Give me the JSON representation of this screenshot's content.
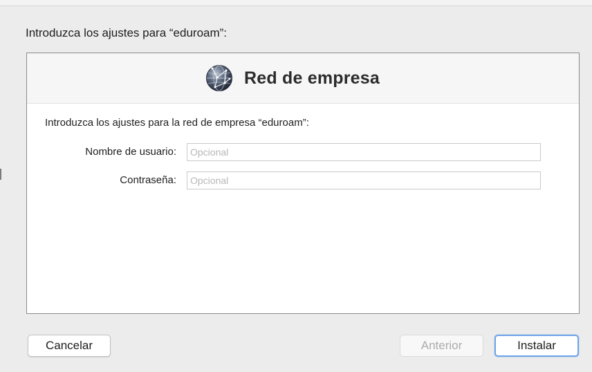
{
  "dialog": {
    "prompt": "Introduzca los ajustes para “eduroam”:"
  },
  "panel": {
    "icon": "network-globe-icon",
    "title": "Red de empresa",
    "instructions": "Introduzca los ajustes para la red de empresa “eduroam”:",
    "fields": {
      "username": {
        "label": "Nombre de usuario:",
        "value": "",
        "placeholder": "Opcional"
      },
      "password": {
        "label": "Contraseña:",
        "value": "",
        "placeholder": "Opcional"
      }
    }
  },
  "buttons": {
    "cancel": "Cancelar",
    "previous": "Anterior",
    "install": "Instalar"
  },
  "colors": {
    "background": "#ececec",
    "panel": "#ffffff",
    "focus_ring": "#6fa4e6",
    "disabled_text": "#ababab"
  }
}
